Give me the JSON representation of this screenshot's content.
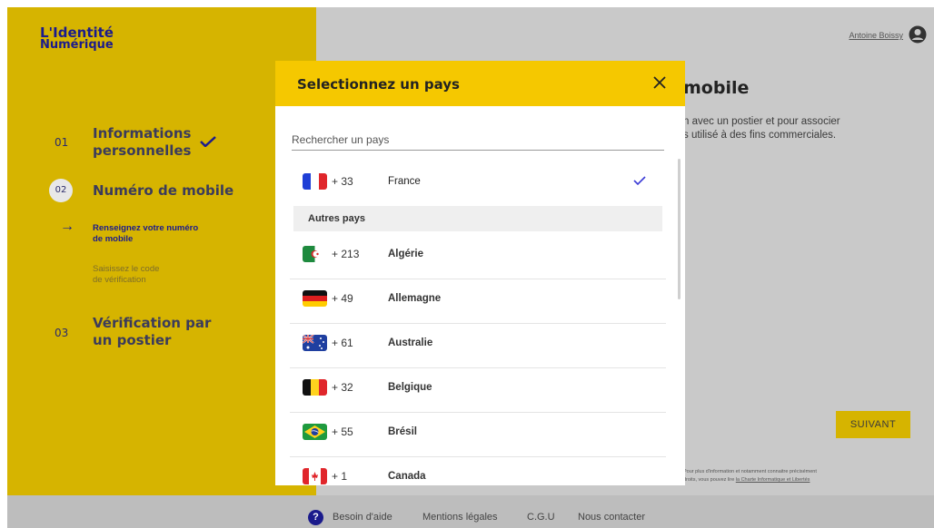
{
  "logo": {
    "line1": "L'Identité",
    "line2": "Numérique"
  },
  "steps": [
    {
      "num": "01",
      "title_line1": "Informations",
      "title_line2": "personnelles",
      "done": true
    },
    {
      "num": "02",
      "title_line1": "Numéro de mobile",
      "active": true,
      "substeps": [
        {
          "line1": "Renseignez votre numéro",
          "line2": "de mobile",
          "active": true
        },
        {
          "line1": "Saisissez le code",
          "line2": "de vérification",
          "active": false
        }
      ]
    },
    {
      "num": "03",
      "title_line1": "Vérification par",
      "title_line2": "un postier"
    }
  ],
  "header": {
    "user_name": "Antoine Boissy"
  },
  "background": {
    "heading": "mobile",
    "text_line1": "n avec un postier et pour associer",
    "text_line2": "s utilisé à des fins commerciales.",
    "next_button": "SUIVANT",
    "small_line1": "Pour plus d'information et notamment connaitre précisément",
    "small_line2_prefix": "droits, vous pouvez lire ",
    "small_line2_link": "la Charte Informatique et Libertés"
  },
  "modal": {
    "title": "Selectionnez un pays",
    "search_placeholder": "Rechercher un pays",
    "section_label": "Autres pays",
    "selected": {
      "code": "+ 33",
      "name": "France"
    },
    "countries": [
      {
        "code": "+ 213",
        "name": "Algérie",
        "flag": "algeria"
      },
      {
        "code": "+ 49",
        "name": "Allemagne",
        "flag": "germany"
      },
      {
        "code": "+ 61",
        "name": "Australie",
        "flag": "australia"
      },
      {
        "code": "+ 32",
        "name": "Belgique",
        "flag": "belgium"
      },
      {
        "code": "+ 55",
        "name": "Brésil",
        "flag": "brazil"
      },
      {
        "code": "+ 1",
        "name": "Canada",
        "flag": "canada"
      }
    ]
  },
  "footer": {
    "help": "Besoin d'aide",
    "legal": "Mentions légales",
    "cgu": "C.G.U",
    "contact": "Nous contacter"
  },
  "colors": {
    "brand_yellow": "#f5c800",
    "sidebar_yellow": "#d6b400",
    "brand_navy": "#1b1b8c"
  }
}
